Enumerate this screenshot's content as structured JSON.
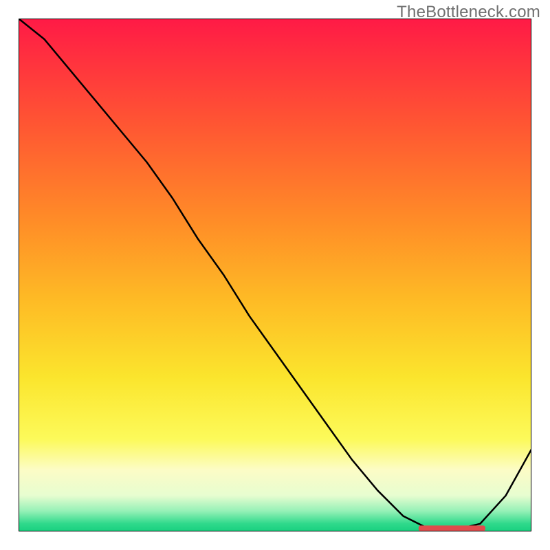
{
  "watermark": "TheBottleneck.com",
  "chart_data": {
    "type": "line",
    "title": "",
    "xlabel": "",
    "ylabel": "",
    "xlim": [
      0,
      100
    ],
    "ylim": [
      0,
      100
    ],
    "x": [
      0,
      5,
      10,
      15,
      20,
      25,
      30,
      35,
      40,
      45,
      50,
      55,
      60,
      65,
      70,
      75,
      80,
      85,
      90,
      95,
      100
    ],
    "values": [
      100,
      96,
      90,
      84,
      78,
      72,
      65,
      57,
      50,
      42,
      35,
      28,
      21,
      14,
      8,
      3,
      0.5,
      0.3,
      1.5,
      7,
      16
    ],
    "background_gradient": {
      "type": "vertical",
      "stops": [
        {
          "offset": 0.0,
          "color": "#FF1A46"
        },
        {
          "offset": 0.2,
          "color": "#FF5433"
        },
        {
          "offset": 0.4,
          "color": "#FF8E27"
        },
        {
          "offset": 0.55,
          "color": "#FEBB25"
        },
        {
          "offset": 0.7,
          "color": "#FBE52D"
        },
        {
          "offset": 0.82,
          "color": "#FCFA5A"
        },
        {
          "offset": 0.88,
          "color": "#FCFCC6"
        },
        {
          "offset": 0.93,
          "color": "#E7FDD0"
        },
        {
          "offset": 0.96,
          "color": "#96F1B7"
        },
        {
          "offset": 0.985,
          "color": "#2FD98B"
        },
        {
          "offset": 1.0,
          "color": "#18D080"
        }
      ]
    },
    "marker_band": {
      "x_start": 78,
      "x_end": 91,
      "y": 0.6,
      "thickness": 1.1,
      "color": "#E04C4C"
    }
  }
}
